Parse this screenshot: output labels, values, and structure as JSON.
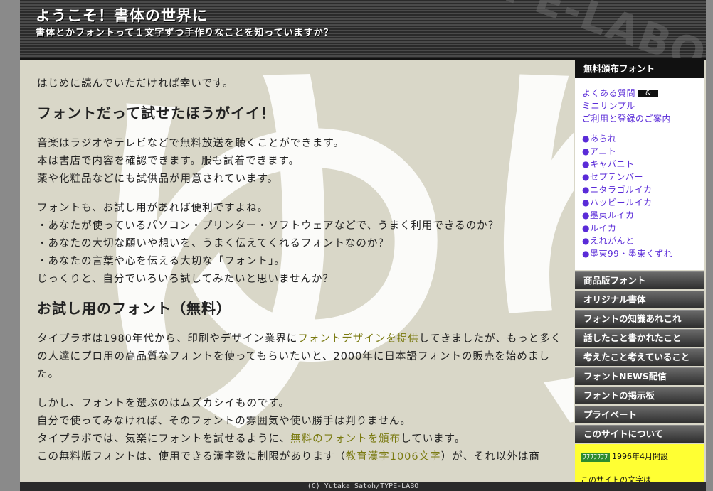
{
  "header": {
    "title": "ようこそ！書体の世界に",
    "subtitle": "書体とかフォントって１文字ずつ手作りなことを知っていますか？",
    "watermark": "TYPE-LABO"
  },
  "main": {
    "bg_chars": "ゆり",
    "intro": "はじめに読んでいただければ幸いです。",
    "h1": "フォントだって試せたほうがイイ！",
    "p1": [
      "音楽はラジオやテレビなどで無料放送を聴くことができます。",
      "本は書店で内容を確認できます。服も試着できます。",
      "薬や化粧品などにも試供品が用意されています。"
    ],
    "p2": [
      "フォントも、お試し用があれば便利ですよね。",
      "・あなたが使っているパソコン・プリンター・ソフトウェアなどで、うまく利用できるのか？",
      "・あなたの大切な願いや想いを、うまく伝えてくれるフォントなのか？",
      "・あなたの言葉や心を伝える大切な「フォント」。",
      "じっくりと、自分でいろいろ試してみたいと思いませんか？"
    ],
    "h2": "お試し用のフォント（無料）",
    "p3_a": "タイプラボは1980年代から、印刷やデザイン業界に",
    "p3_link": "フォントデザインを提供",
    "p3_b": "してきましたが、もっと多くの人達にプロ用の高品質なフォントを使ってもらいたいと、2000年に日本語フォントの販売を始めました。",
    "p4_1": "しかし、フォントを選ぶのはムズカシイものです。",
    "p4_2": "自分で使ってみなければ、そのフォントの雰囲気や使い勝手は判りません。",
    "p4_3a": "タイプラボでは、気楽にフォントを試せるように、",
    "p4_3link": "無料のフォントを頒布",
    "p4_3b": "しています。",
    "p4_4a": "この無料版フォントは、使用できる漢字数に制限があります（",
    "p4_4link": "教育漢字1006文字",
    "p4_4b": "）が、それ以外は商"
  },
  "sidebar": {
    "free_head": "無料頒布フォント",
    "faq": "よくある質問",
    "faq_badge": "&",
    "mini_sample": "ミニサンプル",
    "guide": "ご利用と登録のご案内",
    "fonts": [
      "●あられ",
      "●アニト",
      "●キャバニト",
      "●セプテンバー",
      "●ニタラゴルイカ",
      "●ハッピールイカ",
      "●墨東ルイカ",
      "●ルイカ",
      "●えれがんと",
      "●墨東99・墨東くずれ"
    ],
    "nav": [
      "商品版フォント",
      "オリジナル書体",
      "フォントの知識あれこれ",
      "話したこと書かれたこと",
      "考えたこと考えていること",
      "フォントNEWS配信",
      "フォントの掲示板",
      "プライベート",
      "このサイトについて"
    ],
    "since_badge": "ﾌﾌﾌﾌﾌﾌﾌ",
    "since": "1996年4月開設",
    "info": "このサイトの文字は"
  },
  "footer": "(C) Yutaka Satoh/TYPE-LABO"
}
